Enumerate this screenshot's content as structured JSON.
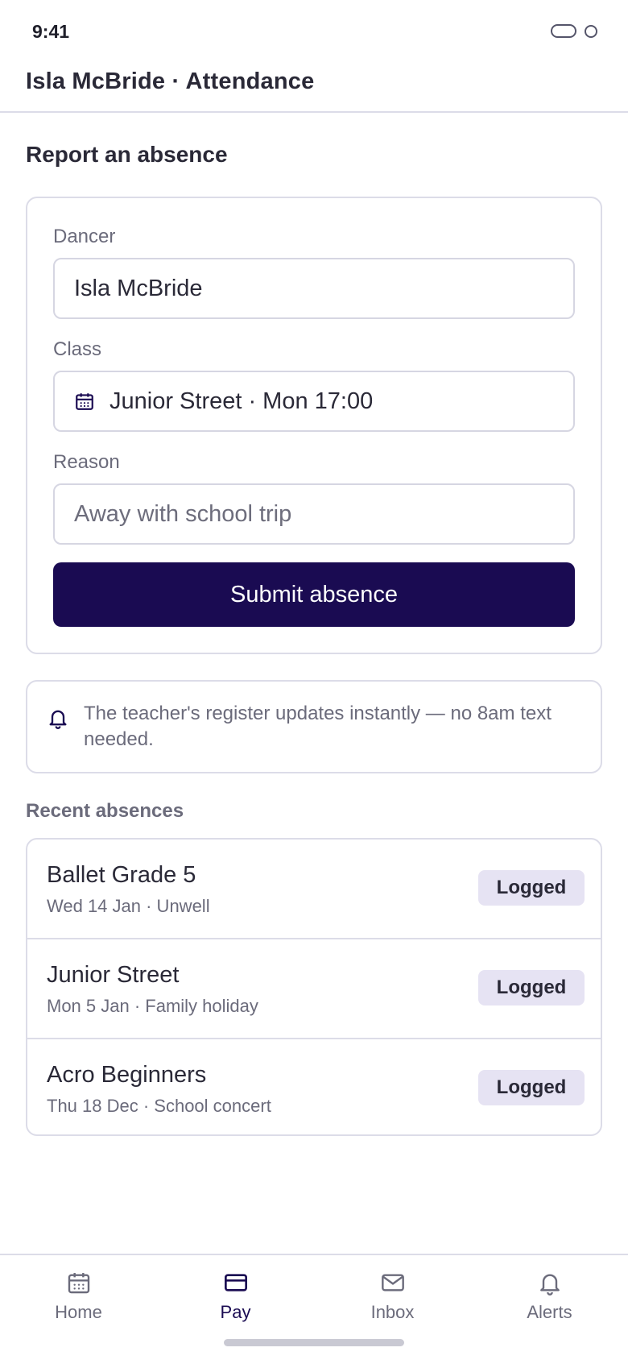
{
  "status": {
    "time": "9:41"
  },
  "header": {
    "title": "Isla McBride · Attendance"
  },
  "form": {
    "section_title": "Report an absence",
    "dancer_label": "Dancer",
    "dancer_value": "Isla McBride",
    "class_label": "Class",
    "class_value": "Junior Street · Mon 17:00",
    "reason_label": "Reason",
    "reason_placeholder": "Away with school trip",
    "submit_label": "Submit absence"
  },
  "info": {
    "text": "The teacher's register updates instantly — no 8am text needed."
  },
  "recent": {
    "label": "Recent absences",
    "items": [
      {
        "title": "Ballet Grade 5",
        "subtitle": "Wed 14 Jan · Unwell",
        "badge": "Logged"
      },
      {
        "title": "Junior Street",
        "subtitle": "Mon 5 Jan · Family holiday",
        "badge": "Logged"
      },
      {
        "title": "Acro Beginners",
        "subtitle": "Thu 18 Dec · School concert",
        "badge": "Logged"
      }
    ]
  },
  "tabs": [
    {
      "label": "Home",
      "icon": "calendar-icon",
      "active": false
    },
    {
      "label": "Pay",
      "icon": "card-icon",
      "active": true
    },
    {
      "label": "Inbox",
      "icon": "mail-icon",
      "active": false
    },
    {
      "label": "Alerts",
      "icon": "bell-icon",
      "active": false
    }
  ],
  "colors": {
    "accent": "#1a0b52",
    "badge_bg": "#e6e3f3",
    "border": "#dcdce8",
    "muted_text": "#6b6b7b"
  }
}
